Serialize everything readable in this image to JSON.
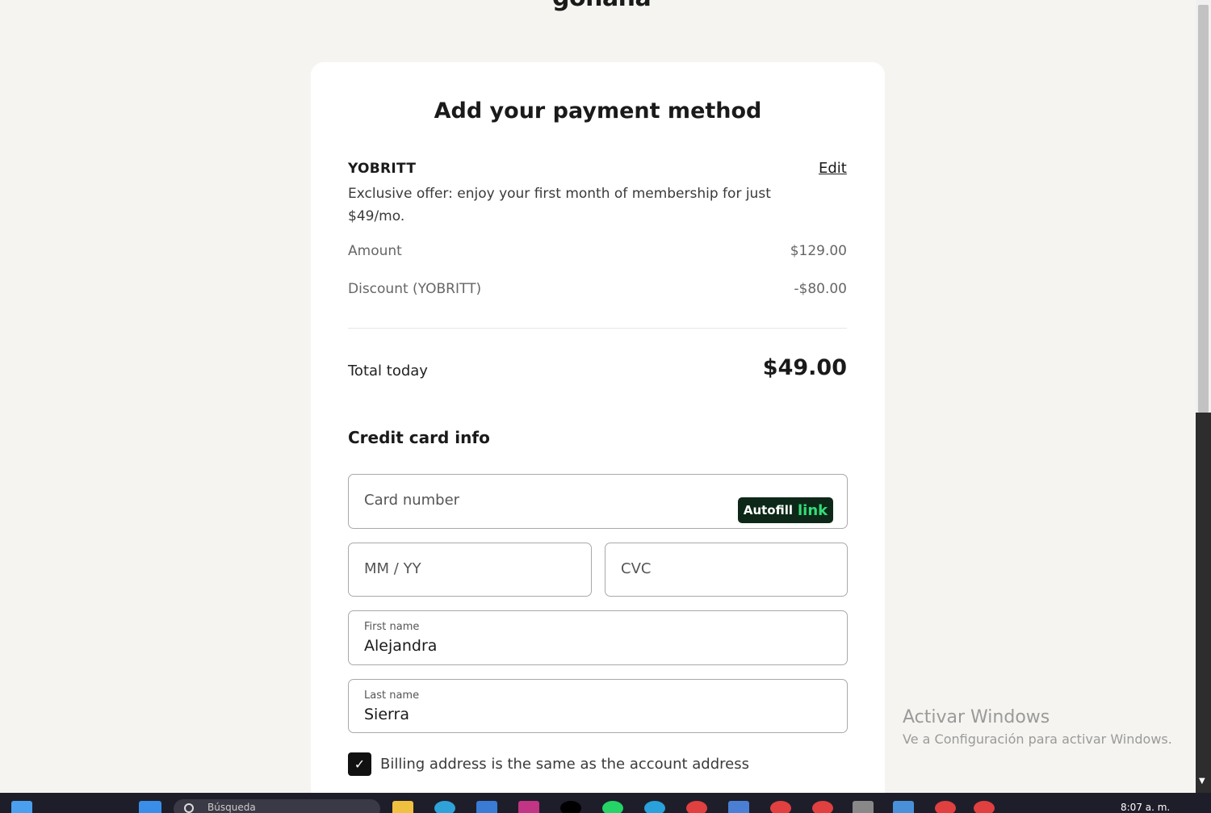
{
  "brand": {
    "logo_text": "gohana"
  },
  "page": {
    "title": "Add your payment method"
  },
  "promo": {
    "code": "YOBRITT",
    "edit_label": "Edit",
    "description": "Exclusive offer: enjoy your first month of membership for just $49/mo."
  },
  "summary": {
    "amount_label": "Amount",
    "amount_value": "$129.00",
    "discount_label": "Discount (YOBRITT)",
    "discount_value": "-$80.00",
    "total_label": "Total today",
    "total_value": "$49.00"
  },
  "credit_card": {
    "section_title": "Credit card info",
    "card_number_placeholder": "Card number",
    "autofill_label": "Autofill",
    "autofill_link": "link",
    "expiry_placeholder": "MM / YY",
    "cvc_placeholder": "CVC",
    "first_name_label": "First name",
    "first_name_value": "Alejandra",
    "last_name_label": "Last name",
    "last_name_value": "Sierra",
    "billing_same_label": "Billing address is the same as the account address",
    "billing_same_checked": true
  },
  "windows": {
    "activate_title": "Activar Windows",
    "activate_sub": "Ve a Configuración para activar Windows.",
    "search_placeholder": "Búsqueda",
    "clock": "8:07 a. m."
  },
  "colors": {
    "page_bg": "#f5f4f0",
    "card_bg": "#ffffff",
    "autofill_bg": "#0d2818",
    "link_green": "#33dd77"
  }
}
